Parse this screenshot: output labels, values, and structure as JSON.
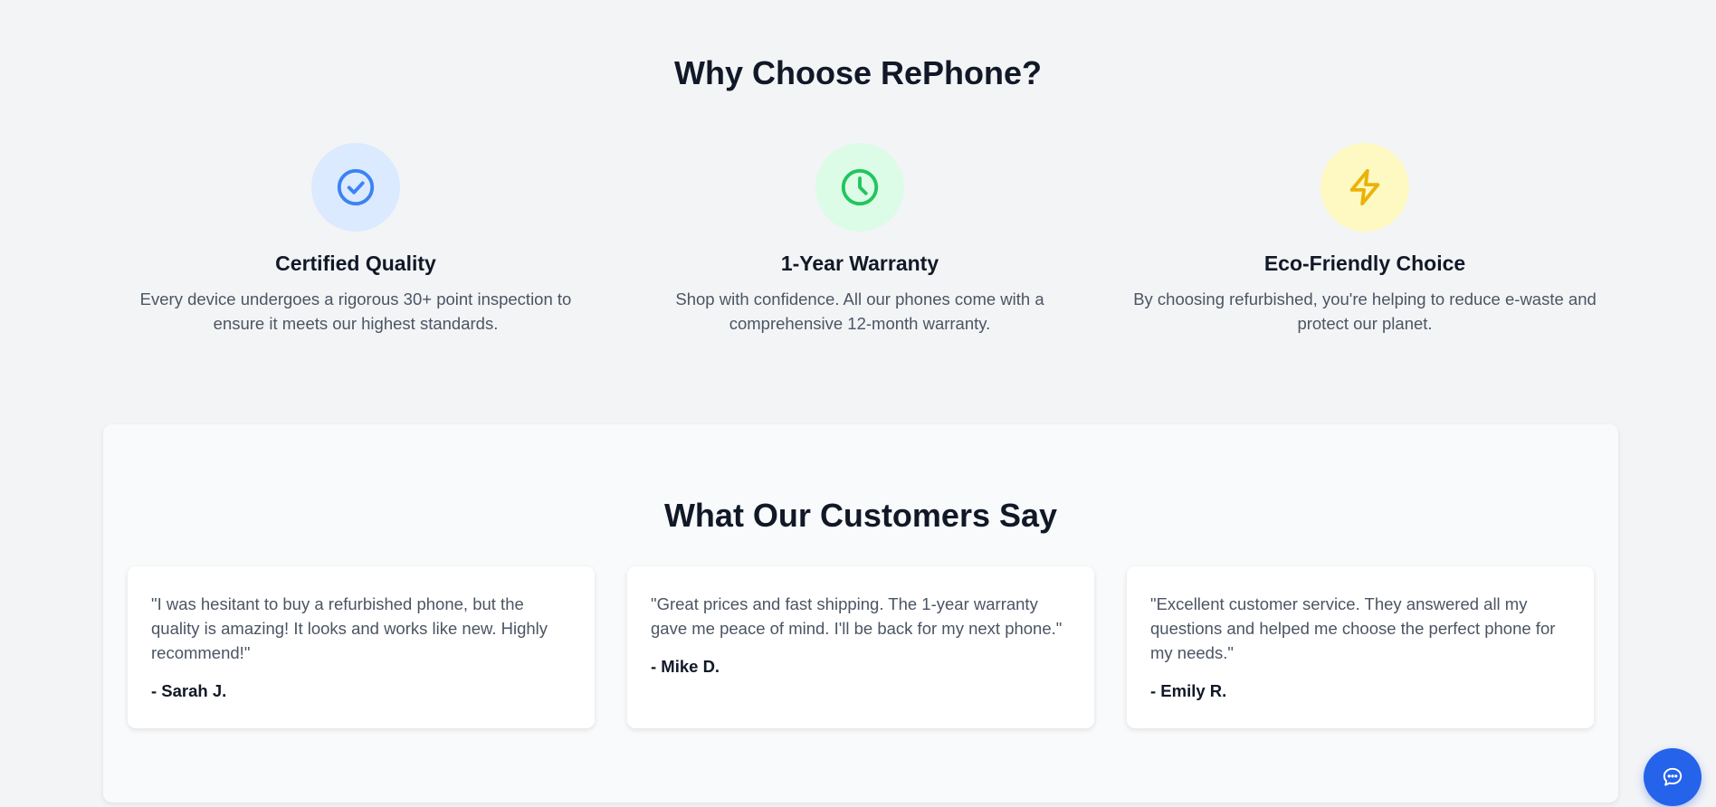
{
  "why_section": {
    "title": "Why Choose RePhone?",
    "features": [
      {
        "icon": "check-circle-icon",
        "title": "Certified Quality",
        "description": "Every device undergoes a rigorous 30+ point inspection to ensure it meets our highest standards.",
        "icon_color": "#3b82f6",
        "circle_color": "#dbeafe"
      },
      {
        "icon": "clock-icon",
        "title": "1-Year Warranty",
        "description": "Shop with confidence. All our phones come with a comprehensive 12-month warranty.",
        "icon_color": "#22c55e",
        "circle_color": "#dcfce7"
      },
      {
        "icon": "lightning-bolt-icon",
        "title": "Eco-Friendly Choice",
        "description": "By choosing refurbished, you're helping to reduce e-waste and protect our planet.",
        "icon_color": "#eab308",
        "circle_color": "#fef9c3"
      }
    ]
  },
  "testimonials": {
    "title": "What Our Customers Say",
    "items": [
      {
        "quote": "\"I was hesitant to buy a refurbished phone, but the quality is amazing! It looks and works like new. Highly recommend!\"",
        "author": "- Sarah J."
      },
      {
        "quote": "\"Great prices and fast shipping. The 1-year warranty gave me peace of mind. I'll be back for my next phone.\"",
        "author": "- Mike D."
      },
      {
        "quote": "\"Excellent customer service. They answered all my questions and helped me choose the perfect phone for my needs.\"",
        "author": "- Emily R."
      }
    ]
  },
  "chat_button": {
    "icon": "chat-bubble-icon",
    "color": "#2563eb"
  }
}
